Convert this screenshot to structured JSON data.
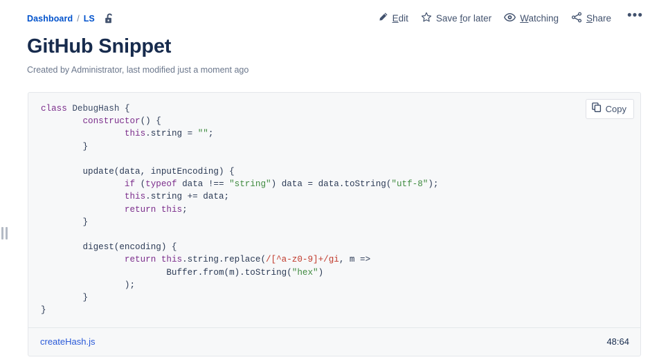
{
  "breadcrumb": {
    "items": [
      {
        "label": "Dashboard"
      },
      {
        "label": "LS"
      }
    ],
    "separator": "/",
    "restriction_icon": "unlocked-padlock-icon"
  },
  "actions": [
    {
      "name": "edit",
      "icon": "pencil-icon",
      "pre": "",
      "key": "E",
      "post": "dit"
    },
    {
      "name": "save-for-later",
      "icon": "star-icon",
      "pre": "Save ",
      "key": "f",
      "post": "or later"
    },
    {
      "name": "watching",
      "icon": "eye-icon",
      "pre": "",
      "key": "W",
      "post": "atching"
    },
    {
      "name": "share",
      "icon": "share-icon",
      "pre": "",
      "key": "S",
      "post": "hare"
    }
  ],
  "more_actions_label": "•••",
  "page": {
    "title": "GitHub Snippet",
    "byline": "Created by Administrator, last modified just a moment ago"
  },
  "code_macro": {
    "copy_label": "Copy",
    "copy_icon": "copy-icon",
    "filename": "createHash.js",
    "position": "48:64",
    "language": "javascript",
    "lines": [
      [
        {
          "t": "key",
          "v": "class"
        },
        {
          "t": "pln",
          "v": " "
        },
        {
          "t": "name",
          "v": "DebugHash"
        },
        {
          "t": "pln",
          "v": " {"
        }
      ],
      [
        {
          "t": "pln",
          "v": "        "
        },
        {
          "t": "key",
          "v": "constructor"
        },
        {
          "t": "pln",
          "v": "() {"
        }
      ],
      [
        {
          "t": "pln",
          "v": "                "
        },
        {
          "t": "key",
          "v": "this"
        },
        {
          "t": "pln",
          "v": ".string = "
        },
        {
          "t": "str",
          "v": "\"\""
        },
        {
          "t": "pln",
          "v": ";"
        }
      ],
      [
        {
          "t": "pln",
          "v": "        }"
        }
      ],
      [
        {
          "t": "pln",
          "v": ""
        }
      ],
      [
        {
          "t": "pln",
          "v": "        update(data, inputEncoding) {"
        }
      ],
      [
        {
          "t": "pln",
          "v": "                "
        },
        {
          "t": "key",
          "v": "if"
        },
        {
          "t": "pln",
          "v": " ("
        },
        {
          "t": "key",
          "v": "typeof"
        },
        {
          "t": "pln",
          "v": " data !== "
        },
        {
          "t": "str",
          "v": "\"string\""
        },
        {
          "t": "pln",
          "v": ") data = data.toString("
        },
        {
          "t": "str",
          "v": "\"utf-8\""
        },
        {
          "t": "pln",
          "v": ");"
        }
      ],
      [
        {
          "t": "pln",
          "v": "                "
        },
        {
          "t": "key",
          "v": "this"
        },
        {
          "t": "pln",
          "v": ".string += data;"
        }
      ],
      [
        {
          "t": "pln",
          "v": "                "
        },
        {
          "t": "key",
          "v": "return"
        },
        {
          "t": "pln",
          "v": " "
        },
        {
          "t": "key",
          "v": "this"
        },
        {
          "t": "pln",
          "v": ";"
        }
      ],
      [
        {
          "t": "pln",
          "v": "        }"
        }
      ],
      [
        {
          "t": "pln",
          "v": ""
        }
      ],
      [
        {
          "t": "pln",
          "v": "        digest(encoding) {"
        }
      ],
      [
        {
          "t": "pln",
          "v": "                "
        },
        {
          "t": "key",
          "v": "return"
        },
        {
          "t": "pln",
          "v": " "
        },
        {
          "t": "key",
          "v": "this"
        },
        {
          "t": "pln",
          "v": ".string.replace("
        },
        {
          "t": "rgx",
          "v": "/[^a-z0-9]+/gi"
        },
        {
          "t": "pln",
          "v": ", m =>"
        }
      ],
      [
        {
          "t": "pln",
          "v": "                        Buffer.from(m).toString("
        },
        {
          "t": "str",
          "v": "\"hex\""
        },
        {
          "t": "pln",
          "v": ")"
        }
      ],
      [
        {
          "t": "pln",
          "v": "                );"
        }
      ],
      [
        {
          "t": "pln",
          "v": "        }"
        }
      ],
      [
        {
          "t": "pln",
          "v": "}"
        }
      ]
    ]
  },
  "colors": {
    "link": "#0052CC",
    "title": "#172B4D",
    "muted": "#6B778C",
    "code_bg": "#F7F8F9",
    "keyword": "#7B2D8B",
    "string": "#3F8A3F",
    "regex": "#C0392B",
    "identifier": "#3B4A66"
  }
}
